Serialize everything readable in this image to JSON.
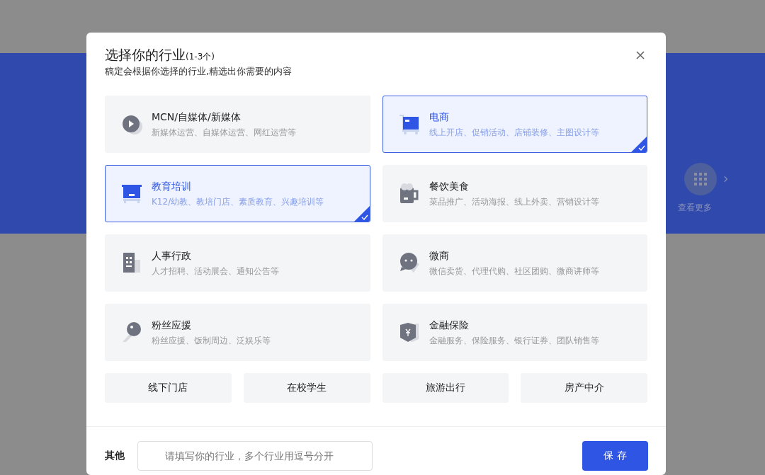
{
  "background": {
    "more_label": "查看更多"
  },
  "dialog": {
    "title": "选择你的行业",
    "title_note": "(1-3个)",
    "subtitle": "稿定会根据你选择的行业,精选出你需要的内容",
    "industries": [
      {
        "name": "MCN/自媒体/新媒体",
        "desc": "新媒体运营、自媒体运营、网红运营等",
        "selected": false
      },
      {
        "name": "电商",
        "desc": "线上开店、促销活动、店铺装修、主图设计等",
        "selected": true
      },
      {
        "name": "教育培训",
        "desc": "K12/幼教、教培门店、素质教育、兴趣培训等",
        "selected": true
      },
      {
        "name": "餐饮美食",
        "desc": "菜品推广、活动海报、线上外卖、营销设计等",
        "selected": false
      },
      {
        "name": "人事行政",
        "desc": "人才招聘、活动展会、通知公告等",
        "selected": false
      },
      {
        "name": "微商",
        "desc": "微信卖货、代理代购、社区团购、微商讲师等",
        "selected": false
      },
      {
        "name": "粉丝应援",
        "desc": "粉丝应援、饭制周边、泛娱乐等",
        "selected": false
      },
      {
        "name": "金融保险",
        "desc": "金融服务、保险服务、银行证券、团队销售等",
        "selected": false
      }
    ],
    "more_industries": [
      {
        "label": "线下门店",
        "selected": false
      },
      {
        "label": "在校学生",
        "selected": false
      },
      {
        "label": "旅游出行",
        "selected": false
      },
      {
        "label": "房产中介",
        "selected": false
      }
    ],
    "other_label": "其他",
    "other_placeholder": "请填写你的行业，多个行业用逗号分开",
    "save_button": "保 存"
  }
}
